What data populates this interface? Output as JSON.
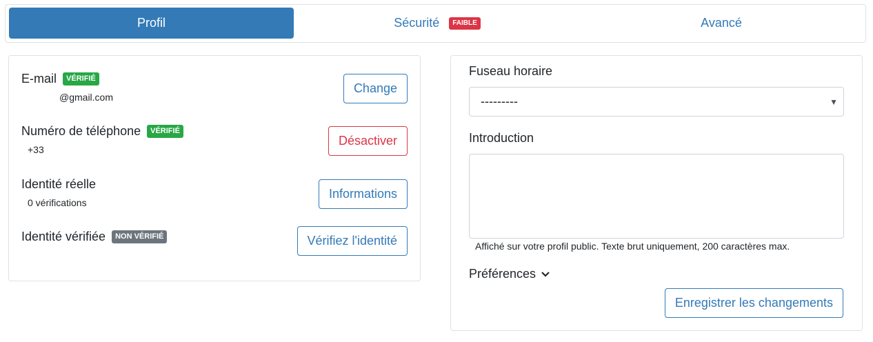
{
  "tabs": [
    {
      "label": "Profil",
      "active": true
    },
    {
      "label": "Sécurité",
      "badge": "FAIBLE",
      "badge_color": "#dc3545"
    },
    {
      "label": "Avancé"
    }
  ],
  "account": {
    "email": {
      "label": "E-mail",
      "badge": "VÉRIFIÉ",
      "value": "@gmail.com",
      "button": "Change"
    },
    "phone": {
      "label": "Numéro de téléphone",
      "badge": "VÉRIFIÉ",
      "value": "+33",
      "button": "Désactiver"
    },
    "identity": {
      "label": "Identité réelle",
      "value": "0 vérifications",
      "button": "Informations"
    },
    "verified_identity": {
      "label": "Identité vérifiée",
      "badge": "NON VÉRIFIÉ",
      "button": "Vérifiez l'identité"
    }
  },
  "settings": {
    "timezone_label": "Fuseau horaire",
    "timezone_value": "---------",
    "intro_label": "Introduction",
    "intro_value": "",
    "intro_help": "Affiché sur votre profil public. Texte brut uniquement, 200 caractères max.",
    "preferences_label": "Préférences",
    "save_button": "Enregistrer les changements"
  },
  "colors": {
    "primary": "#337ab7",
    "success": "#28a745",
    "danger": "#dc3545",
    "secondary": "#6c757d"
  }
}
